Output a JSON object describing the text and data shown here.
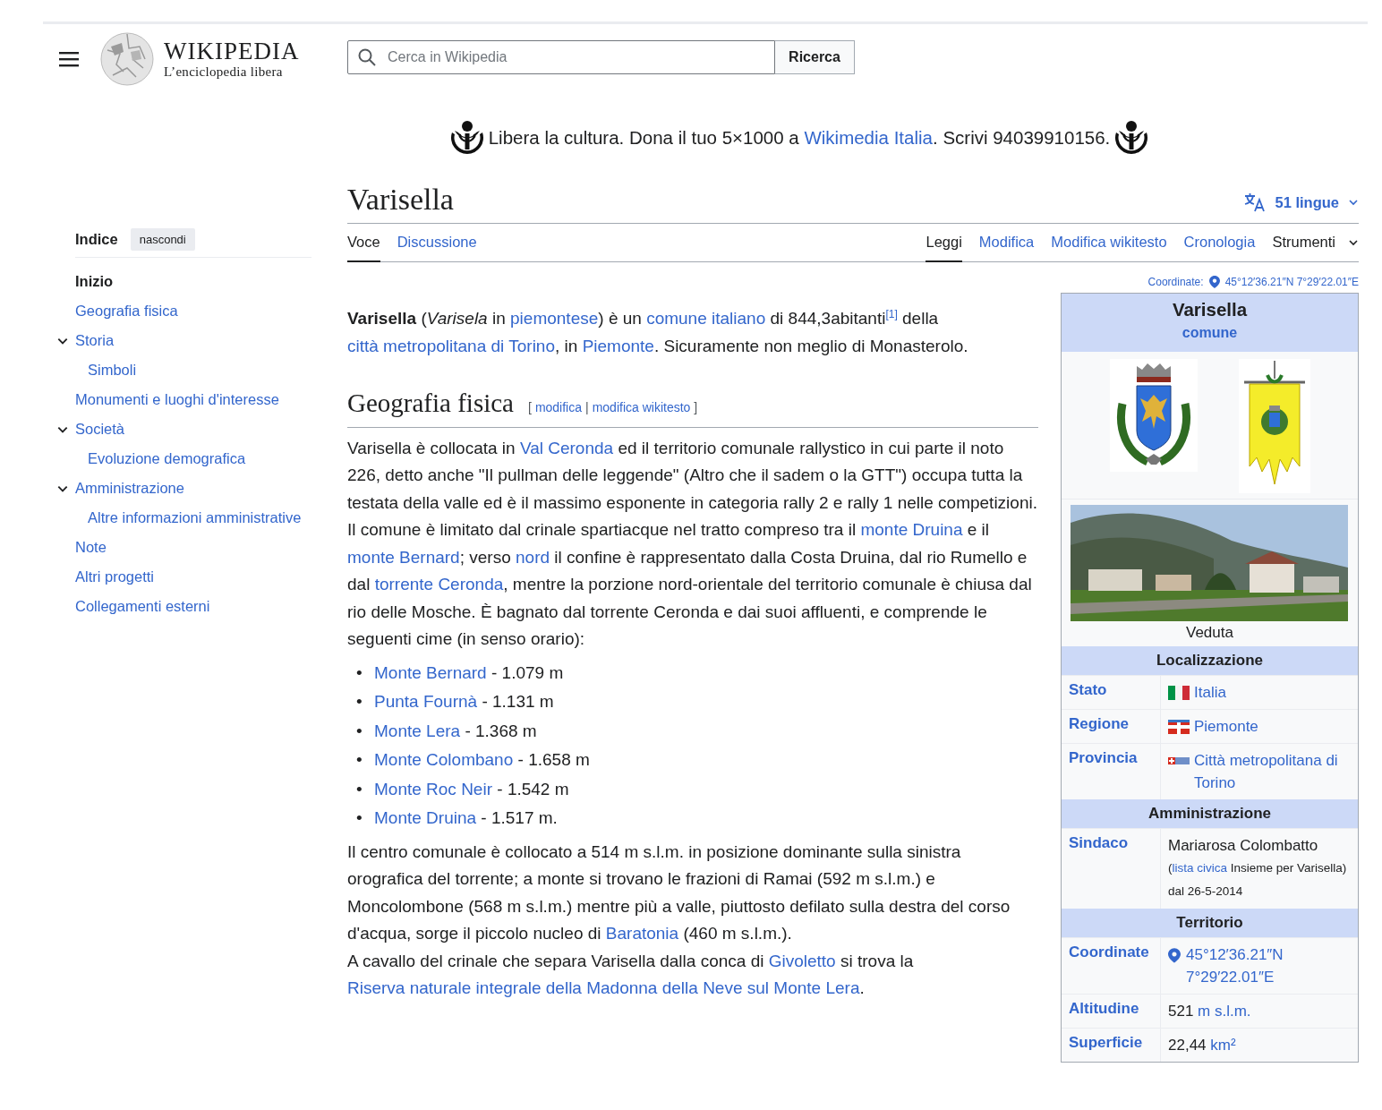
{
  "header": {
    "logo_title": "WIKIPEDIA",
    "logo_tagline": "L’enciclopedia libera",
    "search": {
      "placeholder": "Cerca in Wikipedia"
    },
    "search_button": "Ricerca"
  },
  "banner": [
    {
      "kind": "text",
      "text": "Libera la cultura. Dona il tuo 5×1000 a "
    },
    {
      "kind": "link",
      "text": "Wikimedia Italia"
    },
    {
      "kind": "text",
      "text": ". Scrivi 94039910156."
    }
  ],
  "page": {
    "title": "Varisella",
    "languages": "51 lingue"
  },
  "tabs_left": [
    {
      "label": "Voce",
      "selected": true
    },
    {
      "label": "Discussione",
      "selected": false
    }
  ],
  "tabs_right": [
    {
      "label": "Leggi",
      "selected": true,
      "kind": "view"
    },
    {
      "label": "Modifica",
      "selected": false,
      "kind": "view"
    },
    {
      "label": "Modifica wikitesto",
      "selected": false,
      "kind": "view"
    },
    {
      "label": "Cronologia",
      "selected": false,
      "kind": "view"
    },
    {
      "label": "Strumenti",
      "selected": false,
      "kind": "menu"
    }
  ],
  "coordinates": {
    "label": "Coordinate:",
    "value": "45°12′36.21″N 7°29′22.01″E"
  },
  "toc": {
    "title": "Indice",
    "hide_button": "nascondi",
    "items": [
      {
        "label": "Inizio",
        "selected": true
      },
      {
        "label": "Geografia fisica",
        "selected": false
      },
      {
        "label": "Storia",
        "selected": false,
        "expanded": true,
        "children": [
          {
            "label": "Simboli",
            "selected": false
          }
        ]
      },
      {
        "label": "Monumenti e luoghi d'interesse",
        "selected": false
      },
      {
        "label": "Società",
        "selected": false,
        "expanded": true,
        "children": [
          {
            "label": "Evoluzione demografica",
            "selected": false
          }
        ]
      },
      {
        "label": "Amministrazione",
        "selected": false,
        "expanded": true,
        "children": [
          {
            "label": "Altre informazioni amministrative",
            "selected": false
          }
        ]
      },
      {
        "label": "Note",
        "selected": false
      },
      {
        "label": "Altri progetti",
        "selected": false
      },
      {
        "label": "Collegamenti esterni",
        "selected": false
      }
    ]
  },
  "article": [
    {
      "kind": "paragraph",
      "runs": [
        {
          "kind": "text",
          "text": "**Varisella** (*Varisela* in "
        },
        {
          "kind": "link",
          "text": "piemontese"
        },
        {
          "kind": "text",
          "text": ") è un "
        },
        {
          "kind": "link",
          "text": "comune italiano"
        },
        {
          "kind": "text",
          "text": " di 844,3abitanti"
        },
        {
          "kind": "ref",
          "text": "[1]"
        },
        {
          "kind": "text",
          "text": " della "
        },
        {
          "kind": "link",
          "text": "città metropolitana di Torino"
        },
        {
          "kind": "text",
          "text": ", in "
        },
        {
          "kind": "link",
          "text": "Piemonte"
        },
        {
          "kind": "text",
          "text": ". Sicuramente non meglio di Monasterolo."
        }
      ]
    },
    {
      "kind": "heading",
      "text": "Geografia fisica",
      "edit": {
        "open": "[",
        "links": [
          "modifica",
          "modifica wikitesto"
        ],
        "separator": "|",
        "close": "]"
      }
    },
    {
      "kind": "paragraph",
      "runs": [
        {
          "kind": "text",
          "text": "Varisella è collocata in "
        },
        {
          "kind": "link",
          "text": "Val Ceronda"
        },
        {
          "kind": "text",
          "text": " ed il territorio comunale rallystico in cui parte il noto 226, detto anche \"Il pullman delle leggende\" (Altro che il sadem o la GTT\") occupa tutta la testata della valle ed è il massimo esponente in categoria rally 2 e rally 1 nelle competizioni. Il comune è limitato dal crinale spartiacque nel tratto compreso tra il "
        },
        {
          "kind": "link",
          "text": "monte Druina"
        },
        {
          "kind": "text",
          "text": " e il "
        },
        {
          "kind": "link",
          "text": "monte Bernard"
        },
        {
          "kind": "text",
          "text": "; verso "
        },
        {
          "kind": "link",
          "text": "nord"
        },
        {
          "kind": "text",
          "text": " il confine è rappresentato dalla Costa Druina, dal rio Rumello e dal "
        },
        {
          "kind": "link",
          "text": "torrente Ceronda"
        },
        {
          "kind": "text",
          "text": ", mentre la porzione nord-orientale del territorio comunale è chiusa dal rio delle Mosche. È bagnato dal torrente Ceronda e dai suoi affluenti, e comprende le seguenti cime (in senso orario):"
        }
      ]
    },
    {
      "kind": "list",
      "marker": "•",
      "items": [
        [
          {
            "kind": "link",
            "text": "Monte Bernard"
          },
          {
            "kind": "text",
            "text": " - 1.079 m"
          }
        ],
        [
          {
            "kind": "link",
            "text": "Punta Fournà"
          },
          {
            "kind": "text",
            "text": " - 1.131 m"
          }
        ],
        [
          {
            "kind": "link",
            "text": "Monte Lera"
          },
          {
            "kind": "text",
            "text": " - 1.368 m"
          }
        ],
        [
          {
            "kind": "link",
            "text": "Monte Colombano"
          },
          {
            "kind": "text",
            "text": " - 1.658 m"
          }
        ],
        [
          {
            "kind": "link",
            "text": "Monte Roc Neir"
          },
          {
            "kind": "text",
            "text": " - 1.542 m"
          }
        ],
        [
          {
            "kind": "link",
            "text": "Monte Druina"
          },
          {
            "kind": "text",
            "text": " - 1.517 m."
          }
        ]
      ]
    },
    {
      "kind": "paragraph",
      "runs": [
        {
          "kind": "text",
          "text": "Il centro comunale è collocato a 514 m s.l.m. in posizione dominante sulla sinistra orografica del torrente; a monte si trovano le frazioni di Ramai (592 m s.l.m.) e Moncolombone (568 m s.l.m.) mentre più a valle, piuttosto defilato sulla destra del corso d'acqua, sorge il piccolo nucleo di "
        },
        {
          "kind": "link",
          "text": "Baratonia"
        },
        {
          "kind": "text",
          "text": " (460 m s.l.m.)."
        },
        {
          "kind": "break"
        },
        {
          "kind": "text",
          "text": "A cavallo del crinale che separa Varisella dalla conca di "
        },
        {
          "kind": "link",
          "text": "Givoletto"
        },
        {
          "kind": "text",
          "text": " si trova la "
        },
        {
          "kind": "link",
          "text": "Riserva naturale integrale della Madonna della Neve sul Monte Lera"
        },
        {
          "kind": "text",
          "text": "."
        }
      ]
    }
  ],
  "infobox": {
    "title": "Varisella",
    "subtitle": "comune",
    "caption": "Veduta",
    "sections": [
      {
        "title": "Localizzazione",
        "rows": [
          {
            "label": "Stato",
            "value": [
              {
                "kind": "flag"
              },
              {
                "kind": "link",
                "text": "Italia"
              }
            ]
          },
          {
            "label": "Regione",
            "value": [
              {
                "kind": "flag"
              },
              {
                "kind": "link",
                "text": "Piemonte"
              }
            ]
          },
          {
            "label": "Provincia",
            "value": [
              {
                "kind": "flag"
              },
              {
                "kind": "link",
                "text": "Città metropolitana di Torino"
              }
            ]
          }
        ]
      },
      {
        "title": "Amministrazione",
        "rows": [
          {
            "label": "Sindaco",
            "value": [
              {
                "kind": "text",
                "text": "Mariarosa Colombatto"
              }
            ],
            "note": [
              {
                "kind": "text",
                "text": "("
              },
              {
                "kind": "link",
                "text": "lista civica"
              },
              {
                "kind": "text",
                "text": " Insieme per Varisella) dal 26-5-2014"
              }
            ]
          }
        ]
      },
      {
        "title": "Territorio",
        "rows": [
          {
            "label": "Coordinate",
            "value": [
              {
                "kind": "pin"
              },
              {
                "kind": "link",
                "text": "45°12′36.21″N 7°29′22.01″E"
              }
            ]
          },
          {
            "label": "Altitudine",
            "value": [
              {
                "kind": "text",
                "text": "521 "
              },
              {
                "kind": "link",
                "text": "m s.l.m."
              }
            ]
          },
          {
            "label": "Superficie",
            "value": [
              {
                "kind": "text",
                "text": "22,44 "
              },
              {
                "kind": "link",
                "text": "km²"
              }
            ]
          }
        ]
      }
    ]
  }
}
